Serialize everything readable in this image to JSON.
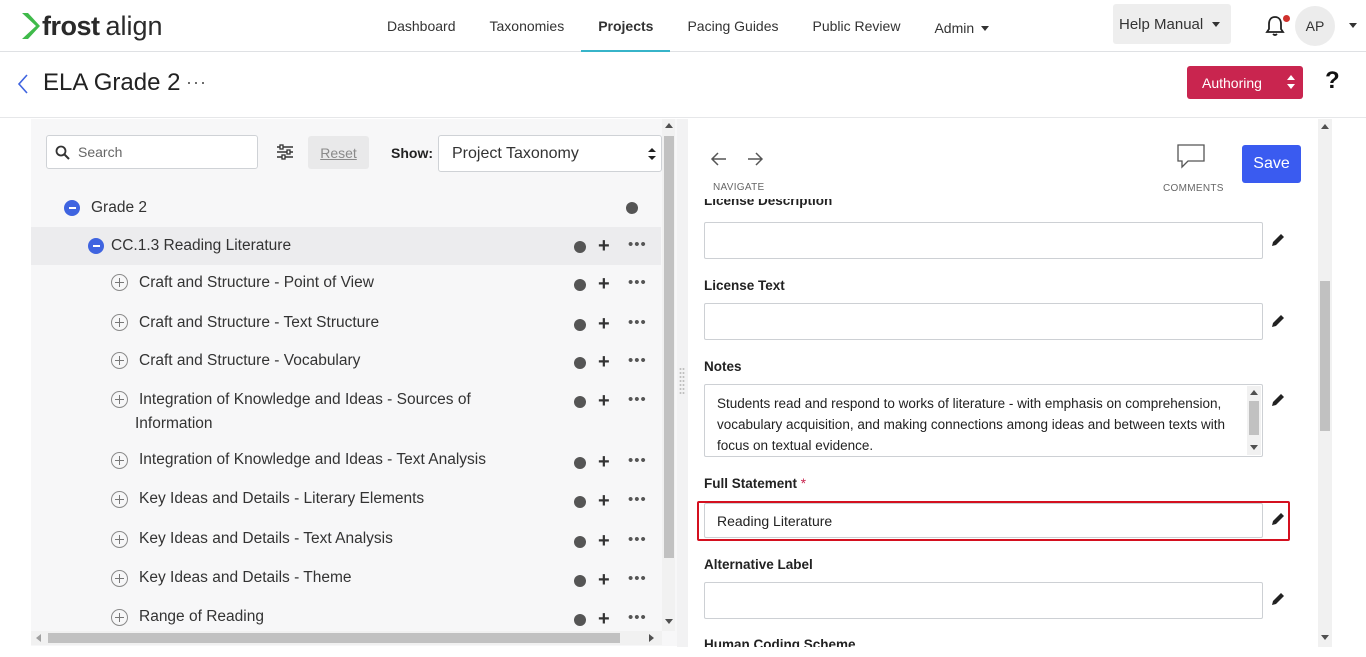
{
  "app": {
    "logo_part1": "frost",
    "logo_part2": "align"
  },
  "nav": {
    "items": [
      {
        "label": "Dashboard"
      },
      {
        "label": "Taxonomies"
      },
      {
        "label": "Projects",
        "active": true
      },
      {
        "label": "Pacing Guides"
      },
      {
        "label": "Public Review"
      },
      {
        "label": "Admin",
        "dropdown": true
      }
    ],
    "help_label": "Help Manual",
    "avatar_initials": "AP",
    "notification_icon": "bell-icon",
    "accent_color": "#37b4c9"
  },
  "header": {
    "title": "ELA Grade 2",
    "more": "···",
    "mode_label": "Authoring",
    "mode_color": "#c9254f",
    "help_symbol": "?"
  },
  "left_panel": {
    "search_placeholder": "Search",
    "reset_label": "Reset",
    "show_label": "Show:",
    "show_value": "Project Taxonomy",
    "tree": [
      {
        "label": "Grade 2",
        "level": 0,
        "expanded": true
      },
      {
        "label": "CC.1.3 Reading Literature",
        "level": 1,
        "expanded": true,
        "selected": true
      },
      {
        "label": "Craft and Structure - Point of View",
        "level": 2
      },
      {
        "label": "Craft and Structure - Text Structure",
        "level": 2
      },
      {
        "label": "Craft and Structure - Vocabulary",
        "level": 2
      },
      {
        "label": "Integration of Knowledge and Ideas - Sources of",
        "label2": "Information",
        "level": 2
      },
      {
        "label": "Integration of Knowledge and Ideas - Text Analysis",
        "level": 2
      },
      {
        "label": "Key Ideas and Details - Literary Elements",
        "level": 2
      },
      {
        "label": "Key Ideas and Details - Text Analysis",
        "level": 2
      },
      {
        "label": "Key Ideas and Details - Theme",
        "level": 2
      },
      {
        "label": "Range of Reading",
        "level": 2
      }
    ]
  },
  "right_panel": {
    "navigate_label": "NAVIGATE",
    "comments_label": "COMMENTS",
    "save_label": "Save",
    "save_color": "#3a5bf0",
    "partial_label_top": "License Description",
    "fields": {
      "license_description_value": "",
      "license_text_label": "License Text",
      "license_text_value": "",
      "notes_label": "Notes",
      "notes_value": "Students read and respond to works of literature - with emphasis on comprehension, vocabulary acquisition, and making connections among ideas and between texts with focus on textual evidence.",
      "full_statement_label": "Full Statement",
      "full_statement_required": "*",
      "full_statement_value": "Reading Literature",
      "alternative_label_label": "Alternative Label",
      "alternative_label_value": "",
      "human_coding_label": "Human Coding Scheme"
    },
    "highlight_color": "#d4101f"
  }
}
